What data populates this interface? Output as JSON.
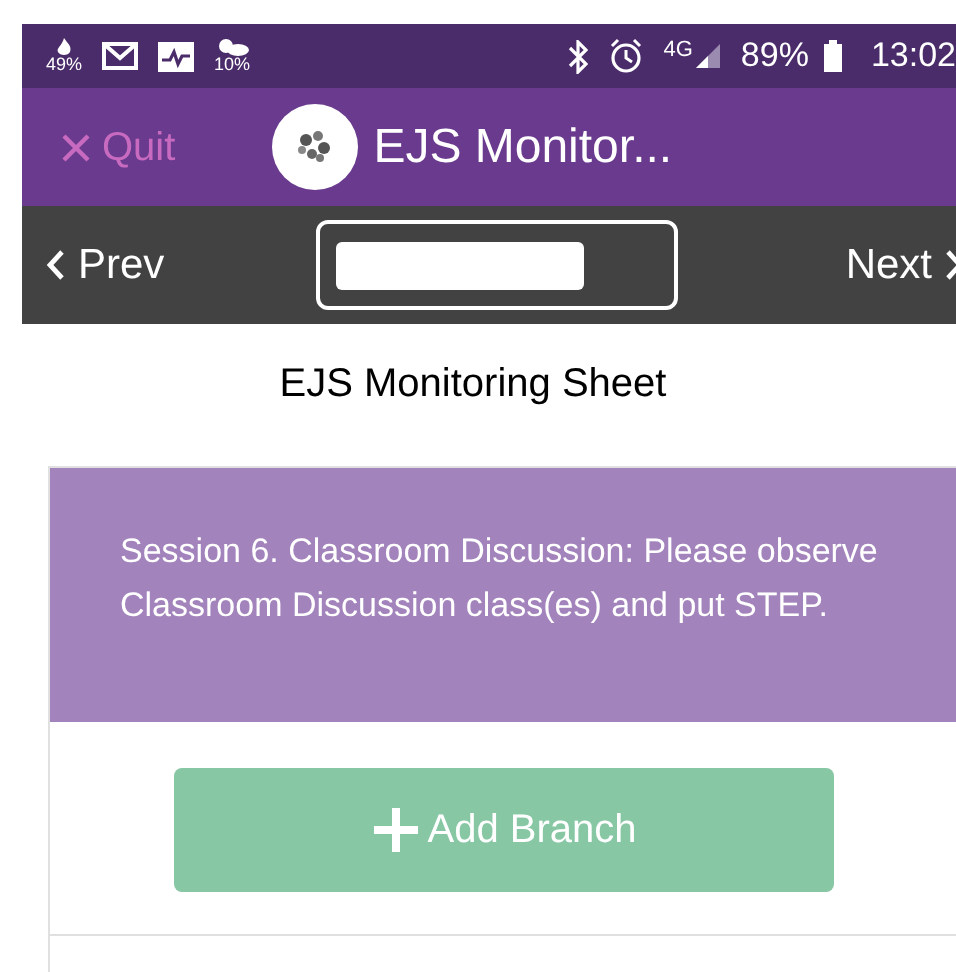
{
  "status_bar": {
    "data_saver": "49%",
    "weather": "10%",
    "network": "4G",
    "battery": "89%",
    "time": "13:02"
  },
  "header": {
    "quit": "Quit",
    "title": "EJS Monitor..."
  },
  "nav": {
    "prev": "Prev",
    "next": "Next"
  },
  "sheet_title": "EJS Monitoring Sheet",
  "section": {
    "text": "Session 6. Classroom Discussion: Please observe Classroom Discussion class(es) and put STEP.",
    "button": "Add Branch"
  }
}
